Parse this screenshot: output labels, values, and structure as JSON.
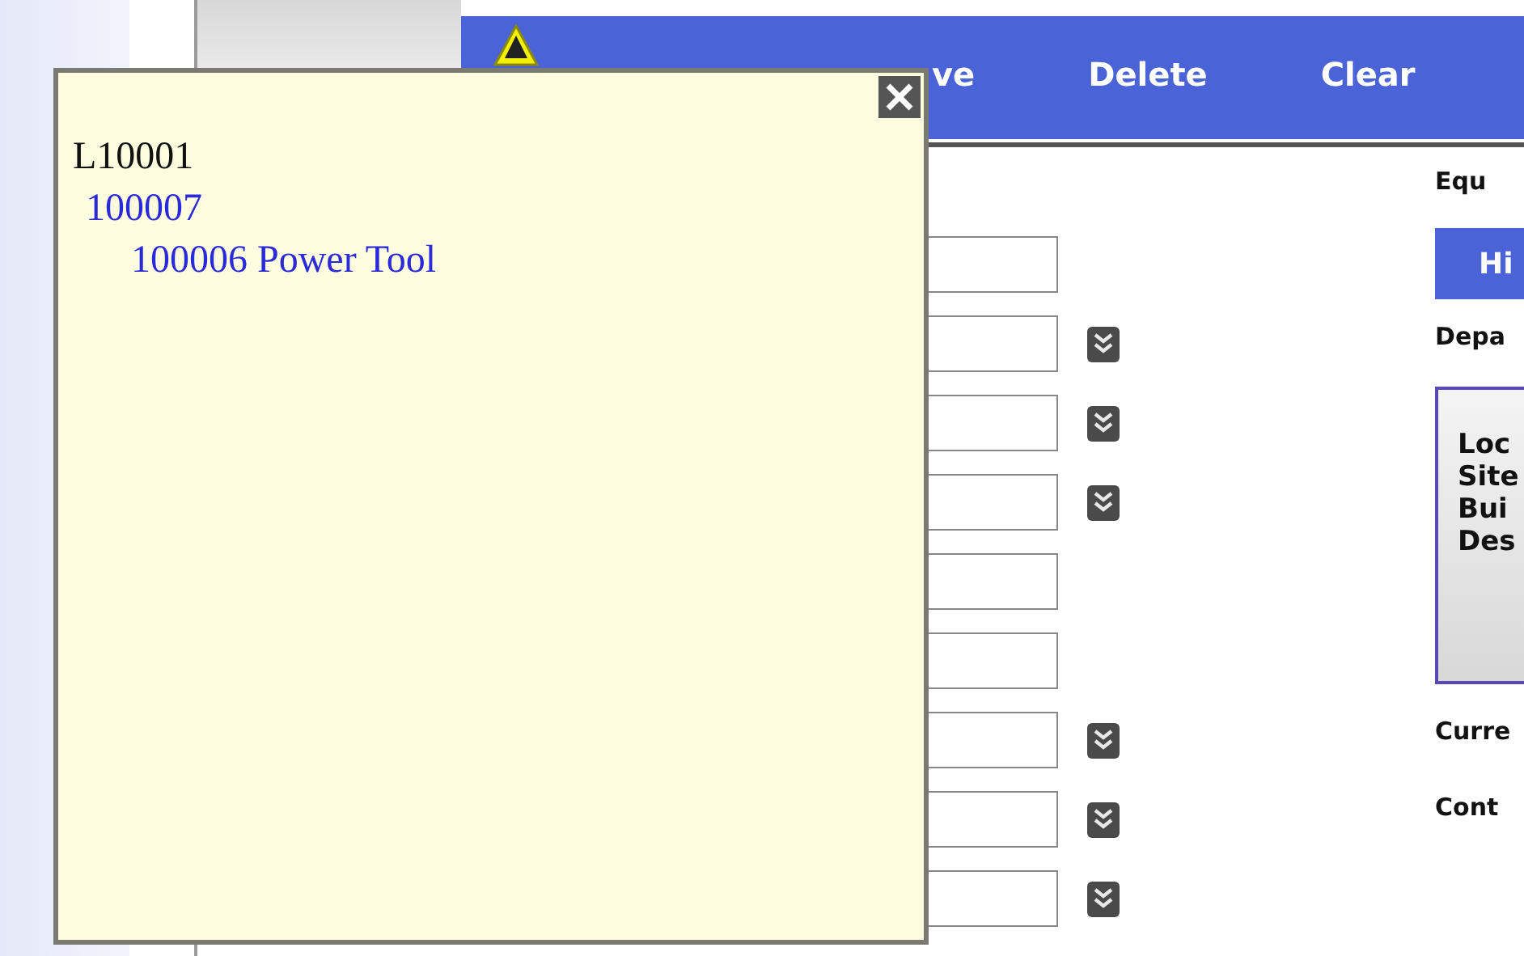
{
  "toolbar": {
    "buttons": [
      {
        "label": "ve"
      },
      {
        "label": "Delete"
      },
      {
        "label": "Clear"
      }
    ]
  },
  "form": {
    "fields": [
      {
        "dropdown": false
      },
      {
        "dropdown": true
      },
      {
        "dropdown": true
      },
      {
        "dropdown": true
      },
      {
        "dropdown": false
      },
      {
        "dropdown": false
      },
      {
        "dropdown": true
      },
      {
        "dropdown": true
      },
      {
        "dropdown": true
      }
    ]
  },
  "right_panel": {
    "label_1": "Equ",
    "button": "Hi",
    "label_2": "Depa",
    "location_box": {
      "lines": [
        "Loc",
        "Site",
        "Bui",
        "Des"
      ]
    },
    "label_3": "Curre",
    "label_4": "Cont"
  },
  "popup": {
    "tree": [
      {
        "label": "L10001",
        "children": [
          {
            "label": "100007",
            "children": [
              {
                "label": "100006 Power Tool"
              }
            ]
          }
        ]
      }
    ]
  }
}
